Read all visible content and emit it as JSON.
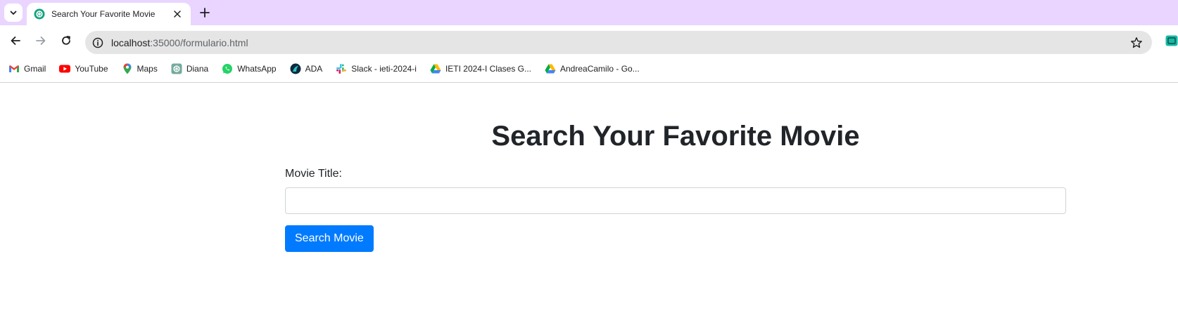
{
  "browser": {
    "tab": {
      "title": "Search Your Favorite Movie",
      "favicon": "openai-knot-icon"
    },
    "url": {
      "host": "localhost",
      "path": ":35000/formulario.html"
    },
    "accent_color": "#e9d5ff",
    "bookmarks": [
      {
        "label": "Gmail",
        "icon": "gmail-icon"
      },
      {
        "label": "YouTube",
        "icon": "youtube-icon"
      },
      {
        "label": "Maps",
        "icon": "maps-icon"
      },
      {
        "label": "Diana",
        "icon": "openai-icon"
      },
      {
        "label": "WhatsApp",
        "icon": "whatsapp-icon"
      },
      {
        "label": "ADA",
        "icon": "ada-icon"
      },
      {
        "label": "Slack - ieti-2024-i",
        "icon": "slack-icon"
      },
      {
        "label": "IETI 2024-I Clases G...",
        "icon": "google-drive-icon"
      },
      {
        "label": "AndreaCamilo - Go...",
        "icon": "google-drive-icon"
      }
    ]
  },
  "page": {
    "title": "Search Your Favorite Movie",
    "form": {
      "label": "Movie Title:",
      "input_value": "",
      "button_label": "Search Movie"
    },
    "button_color": "#007bff"
  }
}
